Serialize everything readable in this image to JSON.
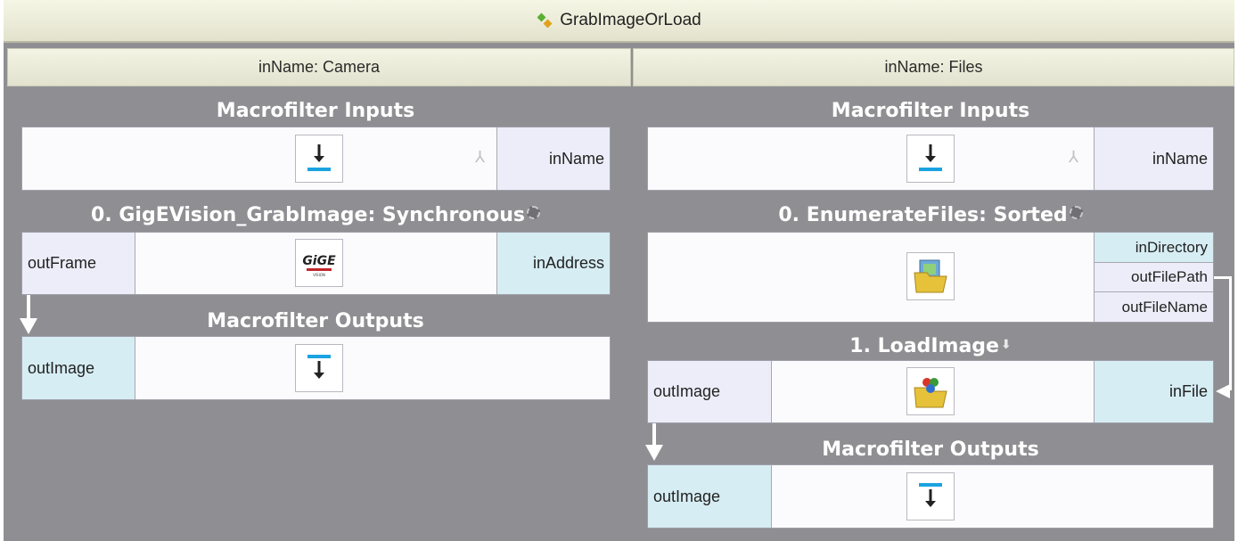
{
  "window": {
    "title": "GrabImageOrLoad"
  },
  "columns": [
    {
      "header": "inName: Camera",
      "inputs_title": "Macrofilter Inputs",
      "input_port": "inName",
      "filter_title": "0. GigEVision_GrabImage: Synchronous",
      "filter_left_port": "outFrame",
      "filter_right_port": "inAddress",
      "filter_logo": "GiGE",
      "outputs_title": "Macrofilter Outputs",
      "output_port": "outImage"
    },
    {
      "header": "inName: Files",
      "inputs_title": "Macrofilter Inputs",
      "input_port": "inName",
      "filter_title": "0. EnumerateFiles: Sorted",
      "filter_ports": [
        "inDirectory",
        "outFilePath",
        "outFileName"
      ],
      "load_title": "1. LoadImage",
      "load_left_port": "outImage",
      "load_right_port": "inFile",
      "outputs_title": "Macrofilter Outputs",
      "output_port": "outImage"
    }
  ],
  "icons": {
    "title": "macro-diamond-icon",
    "input": "input-arrow-icon",
    "output": "output-arrow-icon",
    "gear": "gear-icon",
    "branch": "branch-icon",
    "folder": "folder-image-icon",
    "load": "load-image-icon"
  },
  "colors": {
    "background": "#8f8f93",
    "header": "#ececda",
    "port_cyan": "#d6edf3",
    "port_lavender": "#ecedf8",
    "accent": "#1aa3e0"
  }
}
